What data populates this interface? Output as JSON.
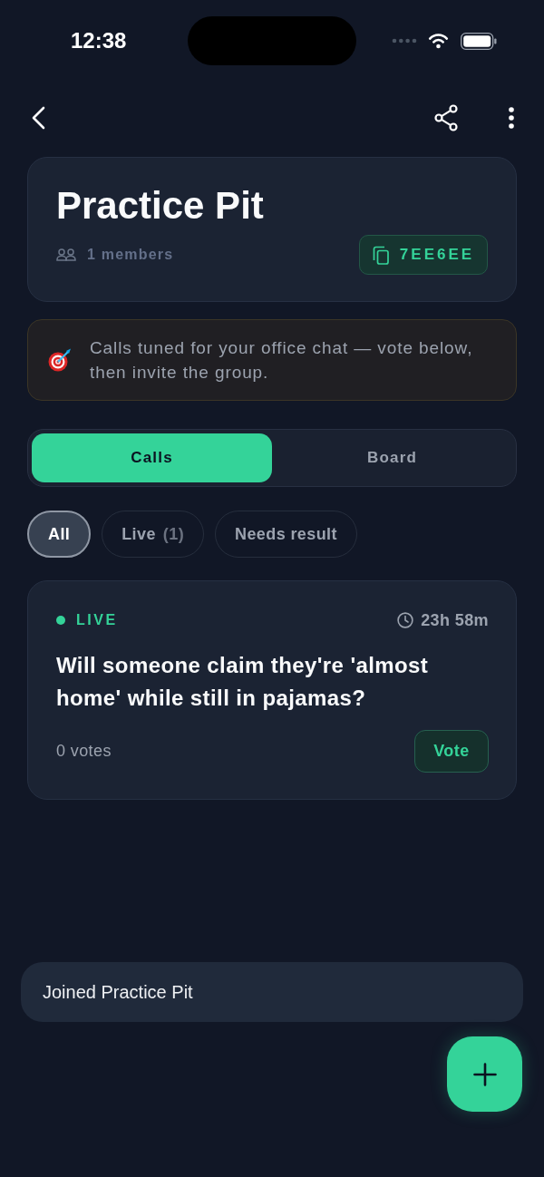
{
  "status_bar": {
    "time": "12:38"
  },
  "group": {
    "name": "Practice Pit",
    "members": "1 members",
    "invite_code": "7EE6EE"
  },
  "banner": {
    "text": "Calls tuned for your office chat — vote below, then invite the group."
  },
  "tabs": [
    {
      "label": "Calls",
      "selected": true
    },
    {
      "label": "Board",
      "selected": false
    }
  ],
  "filters": [
    {
      "label": "All",
      "selected": true
    },
    {
      "label": "Live",
      "count": "(1)",
      "selected": false
    },
    {
      "label": "Needs result",
      "selected": false
    }
  ],
  "calls": [
    {
      "kind": "live",
      "status": "LIVE",
      "time_left": "23h 58m",
      "question": "Will someone claim they're 'almost home' while still in pajamas?",
      "votes": "0 votes",
      "action": "Vote"
    }
  ],
  "toast": {
    "message": "Joined Practice Pit"
  }
}
